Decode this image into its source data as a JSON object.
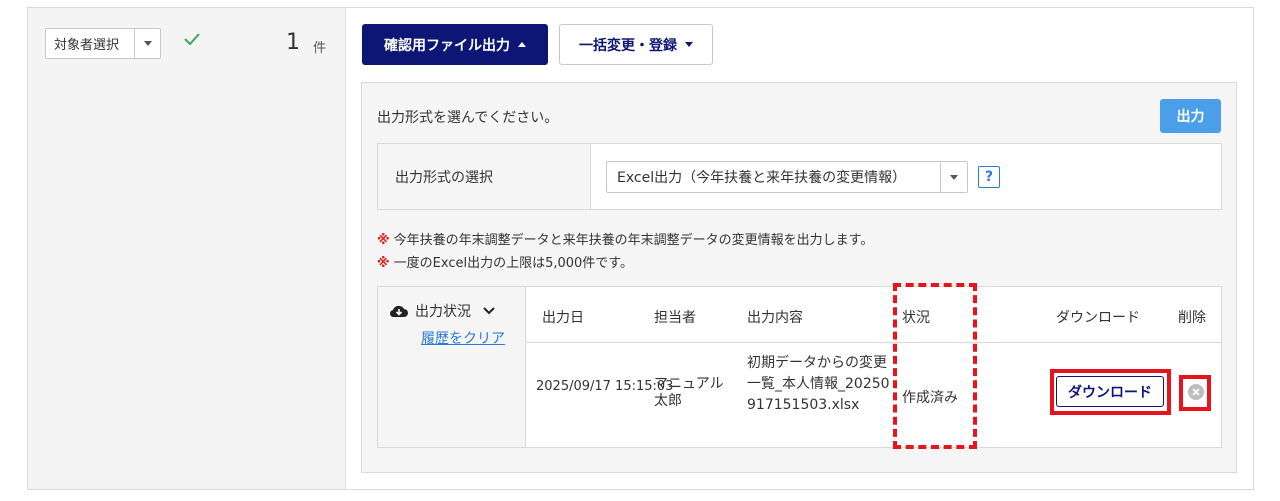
{
  "target_select": {
    "label": "対象者選択"
  },
  "count": {
    "value": "1",
    "unit": "件"
  },
  "toolbar": {
    "confirm_output_label": "確認用ファイル出力",
    "bulk_change_label": "一括変更・登録"
  },
  "panel": {
    "instruction": "出力形式を選んでください。",
    "output_button": "出力",
    "format_label": "出力形式の選択",
    "format_value": "Excel出力（今年扶養と来年扶養の変更情報）",
    "help_label": "?",
    "notes": [
      "今年扶養の年末調整データと来年扶養の年末調整データの変更情報を出力します。",
      "一度のExcel出力の上限は5,000件です。"
    ],
    "note_mark": "※"
  },
  "status_table": {
    "title": "出力状況",
    "clear_link": "履歴をクリア",
    "headers": {
      "date": "出力日",
      "person": "担当者",
      "content": "出力内容",
      "status": "状況",
      "download": "ダウンロード",
      "delete": "削除"
    },
    "rows": [
      {
        "date": "2025/09/17 15:15:03",
        "person": "マニュアル太郎",
        "content": "初期データからの変更一覧_本人情報_20250917151503.xlsx",
        "status": "作成済み",
        "download_label": "ダウンロード"
      }
    ]
  },
  "colors": {
    "primary": "#0e1675",
    "output_button": "#4a9fe8",
    "highlight": "#e8141d",
    "check": "#3aa85a"
  }
}
